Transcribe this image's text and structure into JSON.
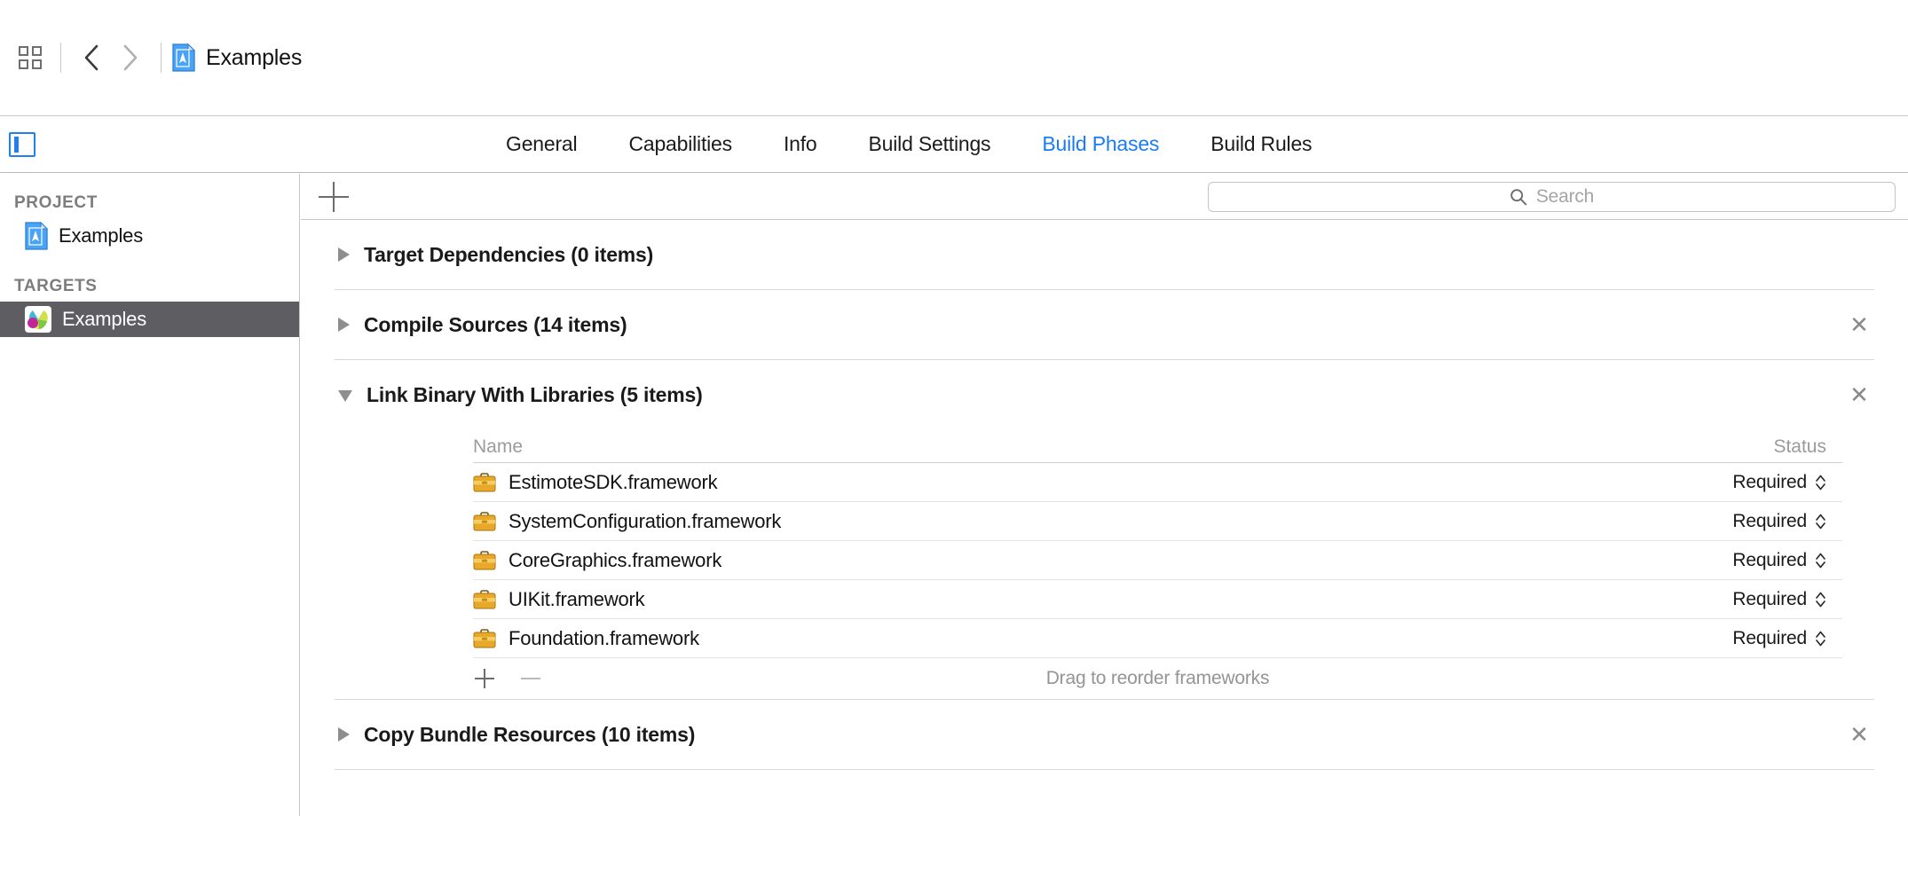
{
  "toolbar": {
    "navigator_icon": "grid-icon",
    "back_icon": "chevron-left-icon",
    "forward_icon": "chevron-right-icon",
    "document_icon": "xcode-project-icon",
    "title": "Examples"
  },
  "tabbar": {
    "panel_toggle_icon": "left-panel-toggle-icon",
    "active_tab": "Build Phases",
    "accent_color": "#1a7cf5",
    "tabs": [
      {
        "label": "General",
        "active": false
      },
      {
        "label": "Capabilities",
        "active": false
      },
      {
        "label": "Info",
        "active": false
      },
      {
        "label": "Build Settings",
        "active": false
      },
      {
        "label": "Build Phases",
        "active": true
      },
      {
        "label": "Build Rules",
        "active": false
      }
    ]
  },
  "sidebar": {
    "project_section_label": "PROJECT",
    "project_item": {
      "label": "Examples",
      "icon": "xcode-project-icon"
    },
    "targets_section_label": "TARGETS",
    "target_item": {
      "label": "Examples",
      "icon": "estimote-app-icon",
      "selected": true
    },
    "selected_row_color": "#5e5e62"
  },
  "filter_bar": {
    "add_phase_icon": "plus-icon",
    "search": {
      "icon": "search-icon",
      "placeholder": "Search",
      "value": ""
    }
  },
  "phases": [
    {
      "title": "Target Dependencies (0 items)",
      "name": "Target Dependencies",
      "count": "0 items",
      "expanded": false,
      "closable": false
    },
    {
      "title": "Compile Sources (14 items)",
      "name": "Compile Sources",
      "count": "14 items",
      "expanded": false,
      "closable": true,
      "close_icon": "close-icon"
    },
    {
      "title": "Link Binary With Libraries (5 items)",
      "name": "Link Binary With Libraries",
      "count": "5 items",
      "expanded": true,
      "closable": true,
      "close_icon": "close-icon",
      "table": {
        "columns": [
          "Name",
          "Status"
        ],
        "rows": [
          {
            "icon": "framework-icon",
            "name": "EstimoteSDK.framework",
            "status": "Required"
          },
          {
            "icon": "framework-icon",
            "name": "SystemConfiguration.framework",
            "status": "Required"
          },
          {
            "icon": "framework-icon",
            "name": "CoreGraphics.framework",
            "status": "Required"
          },
          {
            "icon": "framework-icon",
            "name": "UIKit.framework",
            "status": "Required"
          },
          {
            "icon": "framework-icon",
            "name": "Foundation.framework",
            "status": "Required"
          }
        ],
        "footer": {
          "add_icon": "plus-icon",
          "remove_icon": "minus-icon",
          "hint": "Drag to reorder frameworks"
        }
      }
    },
    {
      "title": "Copy Bundle Resources (10 items)",
      "name": "Copy Bundle Resources",
      "count": "10 items",
      "expanded": false,
      "closable": true,
      "close_icon": "close-icon"
    }
  ]
}
